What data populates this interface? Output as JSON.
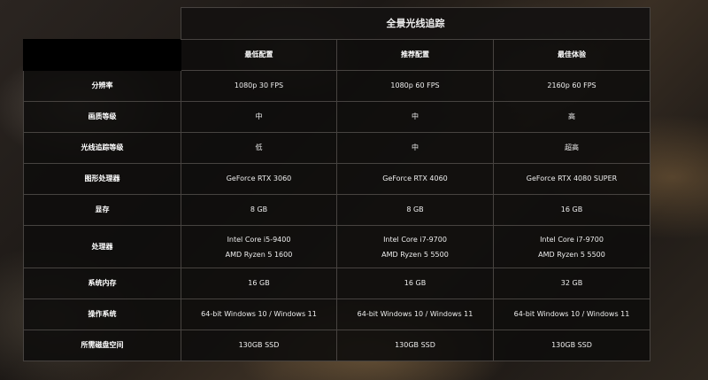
{
  "table": {
    "title": "全景光线追踪",
    "columns": [
      "最低配置",
      "推荐配置",
      "最佳体验"
    ],
    "rows": [
      {
        "label": "分辨率",
        "values": [
          "1080p 30 FPS",
          "1080p 60 FPS",
          "2160p 60 FPS"
        ]
      },
      {
        "label": "画质等级",
        "values": [
          "中",
          "中",
          "高"
        ]
      },
      {
        "label": "光线追踪等级",
        "values": [
          "低",
          "中",
          "超高"
        ]
      },
      {
        "label": "图形处理器",
        "values": [
          "GeForce RTX 3060",
          "GeForce RTX 4060",
          "GeForce RTX 4080 SUPER"
        ]
      },
      {
        "label": "显存",
        "values": [
          "8 GB",
          "8 GB",
          "16 GB"
        ]
      },
      {
        "label": "处理器",
        "values": [
          [
            "Intel Core i5-9400",
            "AMD Ryzen 5 1600"
          ],
          [
            "Intel Core i7-9700",
            "AMD Ryzen 5 5500"
          ],
          [
            "Intel Core i7-9700",
            "AMD Ryzen 5 5500"
          ]
        ]
      },
      {
        "label": "系统内存",
        "values": [
          "16 GB",
          "16 GB",
          "32 GB"
        ]
      },
      {
        "label": "操作系统",
        "values": [
          "64-bit Windows 10 / Windows 11",
          "64-bit Windows 10 / Windows 11",
          "64-bit Windows 10 / Windows 11"
        ]
      },
      {
        "label": "所需磁盘空间",
        "values": [
          "130GB SSD",
          "130GB SSD",
          "130GB SSD"
        ]
      }
    ]
  }
}
